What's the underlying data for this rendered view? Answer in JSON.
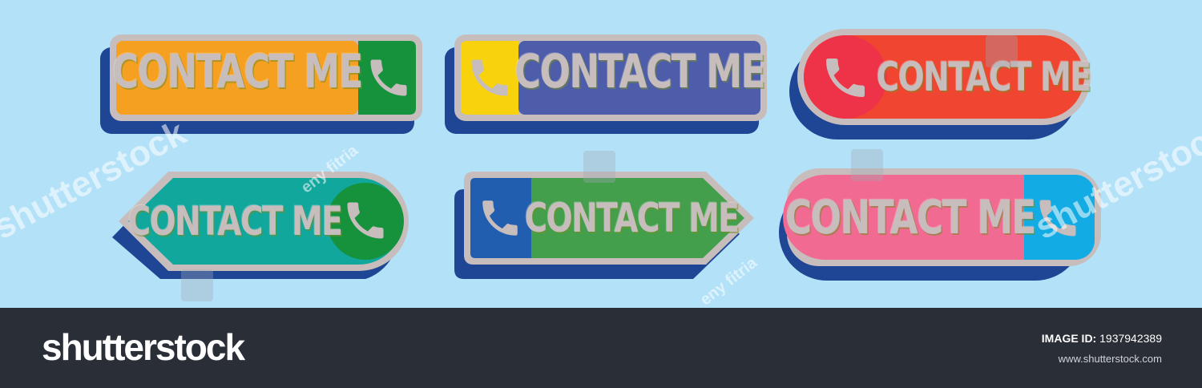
{
  "button_label": "CONTACT ME",
  "icon": "phone-icon",
  "colors": {
    "background": "#b3e2f8",
    "shadow": "#1f4595",
    "border": "#c8bdbd",
    "label": "#c8bdbd",
    "orange": "#f5a020",
    "green": "#16923c",
    "yellow": "#f8d20c",
    "indigo": "#4d5da9",
    "red_orange": "#f04530",
    "red": "#ee3349",
    "teal": "#12a79c",
    "blue": "#215eb0",
    "mid_green": "#439f4c",
    "pink": "#f06a91",
    "sky_blue": "#13abe3",
    "footer": "#2a2e37"
  },
  "watermarks": {
    "brand": "shutterstock",
    "author": "eny fitria"
  },
  "footer": {
    "logo": "shutterstock",
    "image_id_label": "IMAGE ID:",
    "image_id": "1937942389",
    "url": "www.shutterstock.com"
  }
}
